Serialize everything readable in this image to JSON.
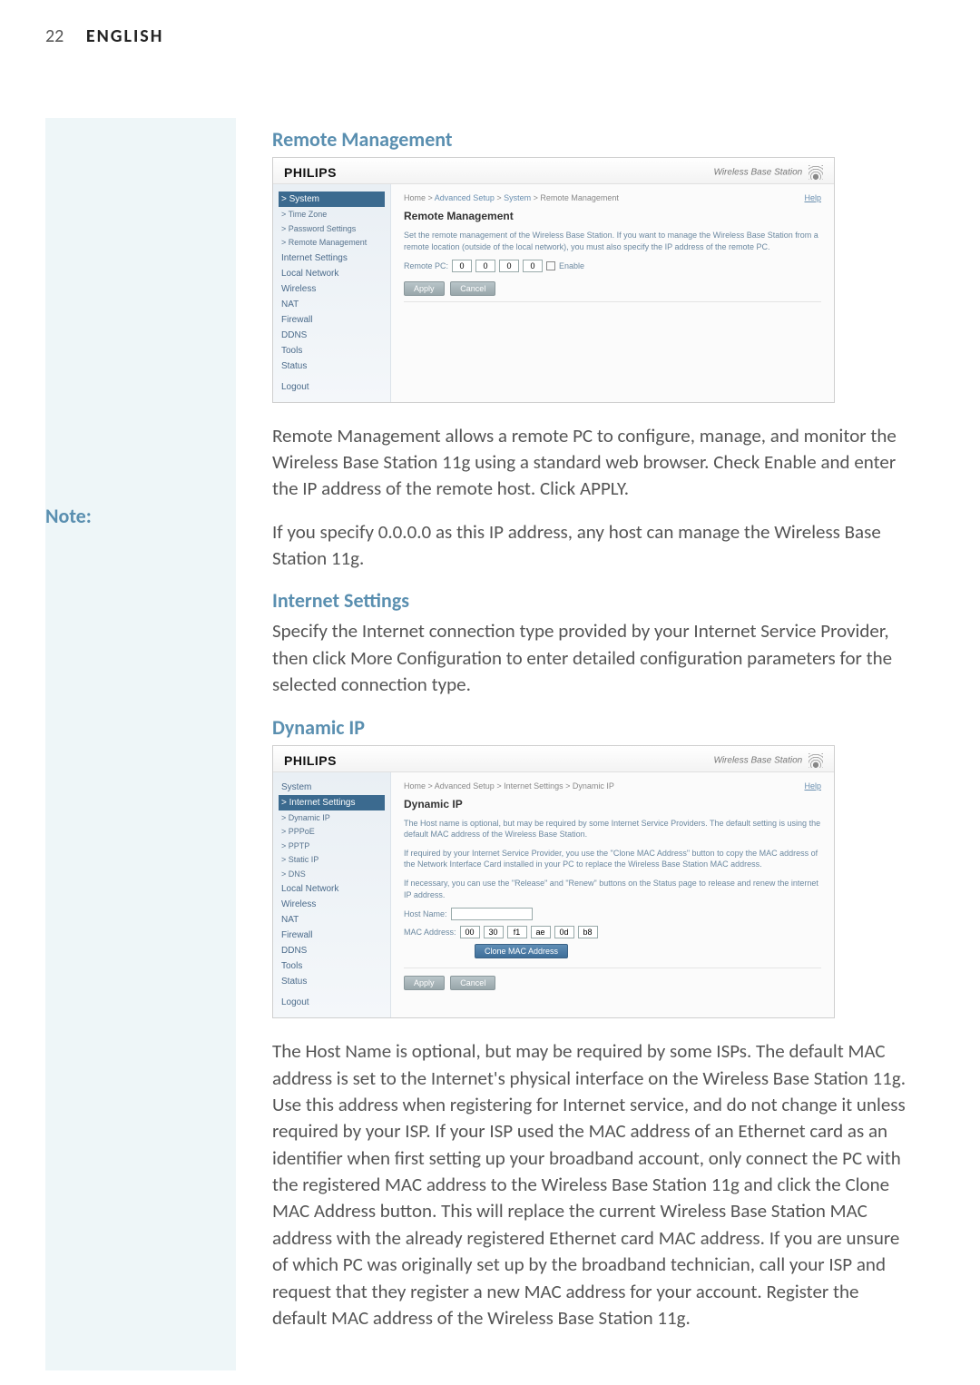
{
  "header": {
    "page_number": "22",
    "language": "ENGLISH"
  },
  "note_label": "Note:",
  "sections": {
    "remote_mgmt": {
      "heading": "Remote Management",
      "para": "Remote Management allows a remote PC to configure, manage, and monitor the Wireless Base Station 11g using a standard web browser. Check Enable and enter the IP address of the remote host. Click APPLY.",
      "note": "If you specify 0.0.0.0 as this IP address, any host can manage the Wireless Base Station 11g."
    },
    "internet_settings": {
      "heading": "Internet Settings",
      "para": "Specify the Internet connection type provided by your Internet Service Provider, then click More Configuration to enter detailed configuration parameters for the selected connection type."
    },
    "dynamic_ip": {
      "heading": "Dynamic IP",
      "para": "The Host Name is optional, but may be required by some ISPs. The default MAC address is set to the Internet's physical interface on the Wireless Base Station 11g. Use this address when registering for Internet service, and do not change it unless required by your ISP. If your ISP used the MAC address of an Ethernet card as an identifier when first setting up your broadband account, only connect the PC with the registered MAC address to the Wireless Base Station 11g and click the Clone MAC Address button. This will replace the current Wireless Base Station MAC address with the already registered Ethernet card MAC address. If you are unsure of which PC was originally set up by the broadband technician, call your ISP and request that they register a new MAC address for your account. Register the default MAC address of the Wireless Base Station 11g."
    }
  },
  "screenshots": {
    "common": {
      "logo": "PHILIPS",
      "brand": "Wireless Base Station",
      "help": "Help",
      "apply": "Apply",
      "cancel": "Cancel"
    },
    "remote": {
      "crumb_prefix": "Home > ",
      "crumb_link1": "Advanced Setup",
      "crumb_mid": " > ",
      "crumb_link2": "System",
      "crumb_tail": " > Remote Management",
      "title": "Remote Management",
      "desc": "Set the remote management of the Wireless Base Station. If you want to manage the Wireless Base Station from a remote location (outside of the local network), you must also specify the IP address of the remote PC.",
      "label_remote_pc": "Remote PC:",
      "ip": [
        "0",
        "0",
        "0",
        "0"
      ],
      "enable": "Enable",
      "nav": {
        "system": "> System",
        "sub1": "> Time Zone",
        "sub2": "> Password Settings",
        "sub3": "> Remote Management",
        "items": [
          "Internet Settings",
          "Local Network",
          "Wireless",
          "NAT",
          "Firewall",
          "DDNS",
          "Tools",
          "Status",
          "Logout"
        ]
      }
    },
    "dynamic": {
      "crumb": "Home > Advanced Setup > Internet Settings > Dynamic IP",
      "title": "Dynamic IP",
      "desc1": "The Host name is optional, but may be required by some Internet Service Providers. The default setting is using the default MAC address of the Wireless Base Station.",
      "desc2": "If required by your Internet Service Provider, you use the \"Clone MAC Address\" button to copy the MAC address of the Network Interface Card installed in your PC to replace the Wireless Base Station MAC address.",
      "desc3": "If necessary, you can use the \"Release\" and \"Renew\" buttons on the Status page to release and renew the internet IP address.",
      "host_name_label": "Host Name:",
      "mac_label": "MAC Address:",
      "mac": [
        "00",
        "30",
        "f1",
        "ae",
        "0d",
        "b8"
      ],
      "clone_btn": "Clone MAC Address",
      "nav": {
        "system": "System",
        "internet": "> Internet Settings",
        "sub1": "> Dynamic IP",
        "sub2": "> PPPoE",
        "sub3": "> PPTP",
        "sub4": "> Static IP",
        "sub5": "> DNS",
        "items": [
          "Local Network",
          "Wireless",
          "NAT",
          "Firewall",
          "DDNS",
          "Tools",
          "Status",
          "Logout"
        ]
      }
    }
  }
}
